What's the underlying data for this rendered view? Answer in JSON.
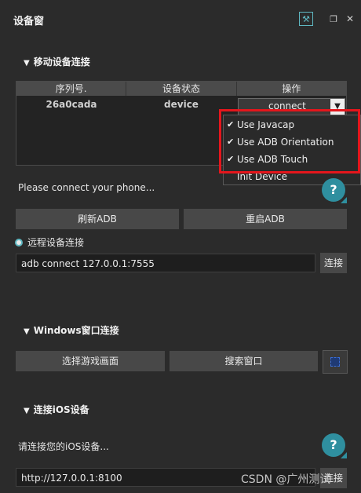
{
  "window": {
    "title": "设备窗",
    "tools_glyph": "⚒",
    "restore_glyph": "❐",
    "close_glyph": "✕"
  },
  "mobile": {
    "section_title": "移动设备连接",
    "table": {
      "headers": [
        "序列号.",
        "设备状态",
        "操作"
      ],
      "rows": [
        {
          "serial": "26a0cada",
          "state": "device",
          "action": "connect"
        }
      ]
    },
    "dropdown_arrow": "▼",
    "menu": [
      {
        "label": "Use Javacap",
        "checked": true
      },
      {
        "label": "Use ADB Orientation",
        "checked": true
      },
      {
        "label": "Use ADB Touch",
        "checked": true
      },
      {
        "label": "Init Device",
        "checked": false
      }
    ],
    "check_glyph": "✔",
    "status": "Please connect your phone...",
    "refresh_adb": "刷新ADB",
    "restart_adb": "重启ADB"
  },
  "remote": {
    "label": "远程设备连接",
    "address": "adb connect 127.0.0.1:7555",
    "connect_btn": "连接"
  },
  "windows": {
    "section_title": "Windows窗口连接",
    "select_screen": "选择游戏画面",
    "search_window": "搜索窗口"
  },
  "ios": {
    "section_title": "连接iOS设备",
    "status": "请连接您的iOS设备...",
    "address": "http://127.0.0.1:8100",
    "connect_btn": "连接"
  },
  "help_glyph": "?",
  "section_glyph": "▼",
  "watermark": "CSDN @广州测试",
  "colors": {
    "accent": "#2f8f9f",
    "highlight": "#e4161c",
    "background": "#2b2b2b"
  }
}
